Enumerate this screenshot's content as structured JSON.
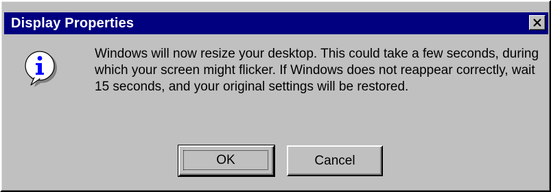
{
  "dialog": {
    "title": "Display Properties",
    "close_symbol": "×",
    "icon": "information-icon",
    "message": "Windows will now resize your desktop. This could take a few seconds, during which your screen might flicker.  If Windows does not reappear correctly, wait 15 seconds, and your original settings will be restored.",
    "buttons": {
      "ok_label": "OK",
      "cancel_label": "Cancel"
    }
  },
  "colors": {
    "titlebar": "#000080",
    "face": "#c0c0c0",
    "title_text": "#ffffff",
    "icon_blue": "#0000ff"
  }
}
